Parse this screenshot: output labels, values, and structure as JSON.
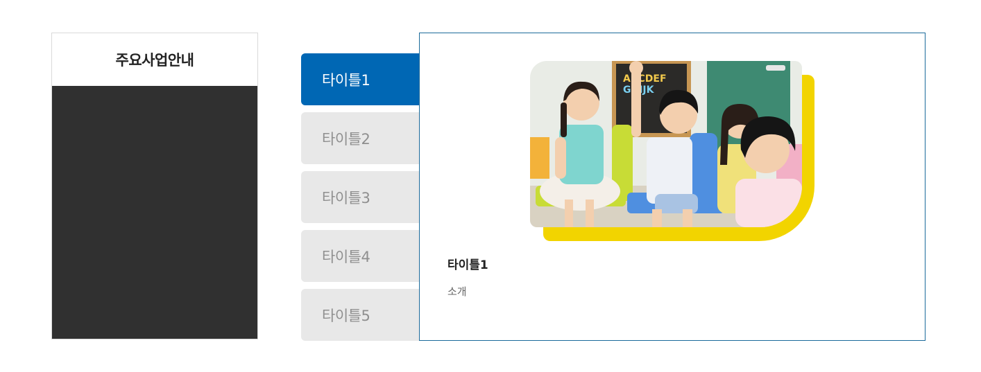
{
  "sidebar": {
    "title": "주요사업안내"
  },
  "tabs": [
    {
      "label": "타이틀1",
      "active": true
    },
    {
      "label": "타이틀2",
      "active": false
    },
    {
      "label": "타이틀3",
      "active": false
    },
    {
      "label": "타이틀4",
      "active": false
    },
    {
      "label": "타이틀5",
      "active": false
    }
  ],
  "content": {
    "title": "타이틀1",
    "description": "소개",
    "image": "classroom-children-photo",
    "blackboard_text": [
      "ABCDEF",
      "GHIJK"
    ]
  },
  "colors": {
    "active_tab": "#0067b4",
    "inactive_tab": "#e8e8e8",
    "panel_border": "#1a6a9a",
    "accent_yellow": "#f2d400",
    "sidebar_dark": "#303030"
  }
}
